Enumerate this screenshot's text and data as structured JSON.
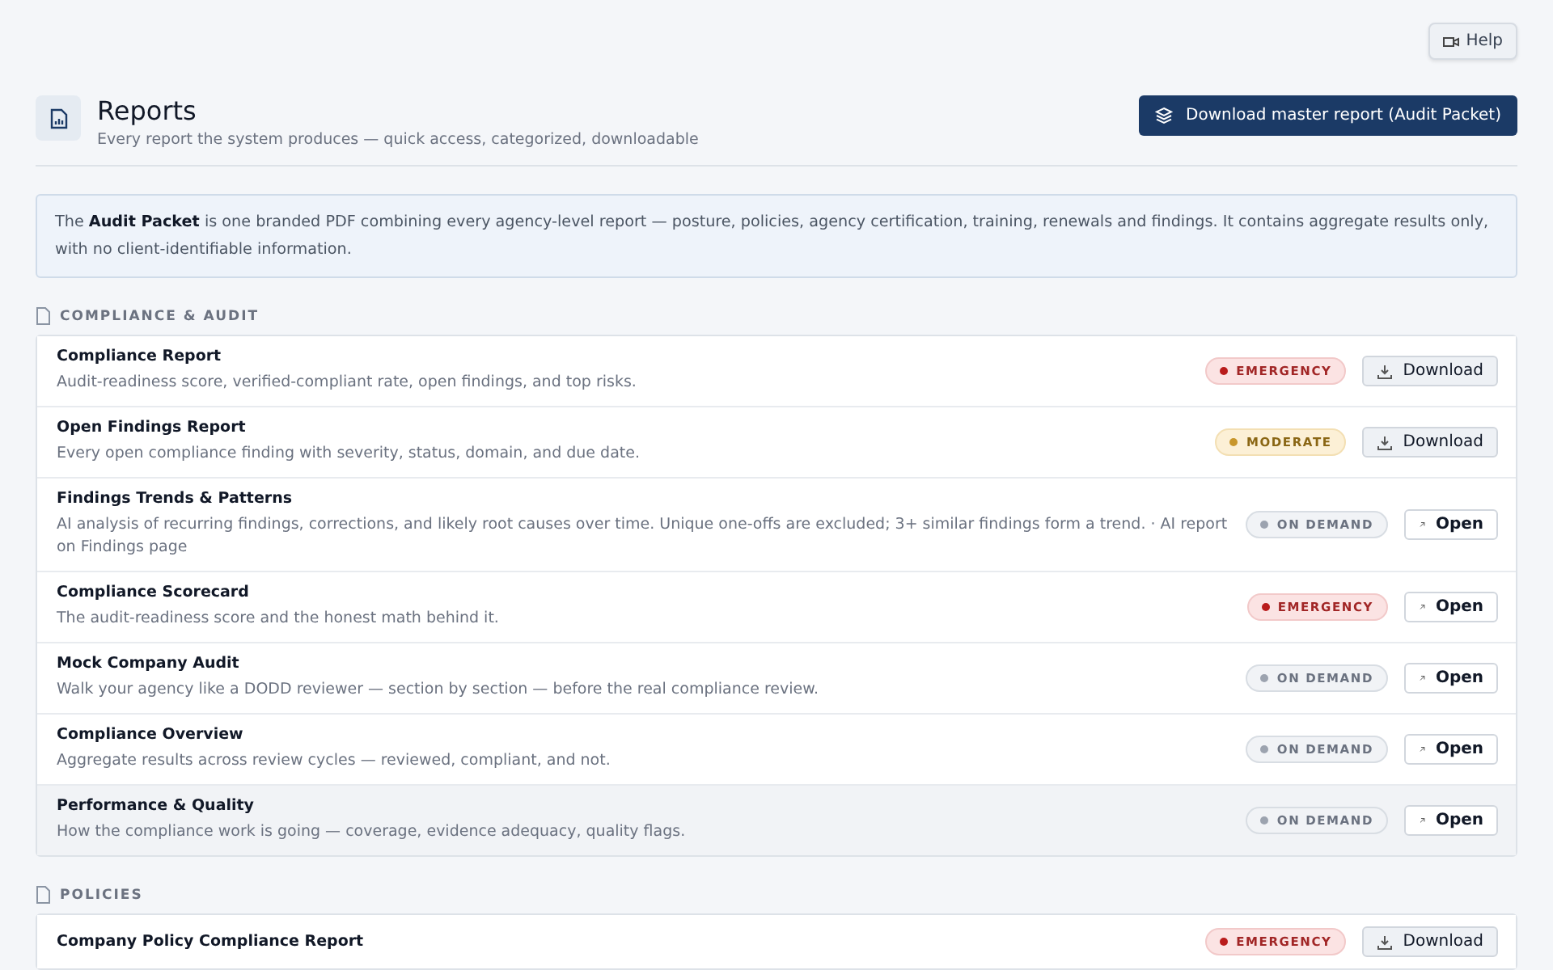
{
  "help_button": "Help",
  "header": {
    "title": "Reports",
    "subtitle": "Every report the system produces — quick access, categorized, downloadable",
    "primary_button": "Download master report (Audit Packet)"
  },
  "info": "The **Audit Packet** is one branded PDF combining every agency-level report — posture, policies, agency certification, training, renewals and findings. It contains aggregate results only, with no client-identifiable information.",
  "sections": [
    {
      "title": "COMPLIANCE & AUDIT",
      "reports": [
        {
          "name": "Compliance Report",
          "description": "Audit-readiness score, verified-compliant rate, open findings, and top risks.",
          "badge": {
            "kind": "emergency",
            "label": "EMERGENCY"
          },
          "action": {
            "kind": "download",
            "label": "Download"
          },
          "highlighted": false
        },
        {
          "name": "Open Findings Report",
          "description": "Every open compliance finding with severity, status, domain, and due date.",
          "badge": {
            "kind": "moderate",
            "label": "MODERATE"
          },
          "action": {
            "kind": "download",
            "label": "Download"
          },
          "highlighted": false
        },
        {
          "name": "Findings Trends & Patterns",
          "description": "AI analysis of recurring findings, corrections, and likely root causes over time. Unique one-offs are excluded; 3+ similar findings form a trend. · AI report on Findings page",
          "badge": {
            "kind": "on_demand",
            "label": "ON DEMAND"
          },
          "action": {
            "kind": "open",
            "label": "Open"
          },
          "highlighted": false
        },
        {
          "name": "Compliance Scorecard",
          "description": "The audit-readiness score and the honest math behind it.",
          "badge": {
            "kind": "emergency",
            "label": "EMERGENCY"
          },
          "action": {
            "kind": "open",
            "label": "Open"
          },
          "highlighted": false
        },
        {
          "name": "Mock Company Audit",
          "description": "Walk your agency like a DODD reviewer — section by section — before the real compliance review.",
          "badge": {
            "kind": "on_demand",
            "label": "ON DEMAND"
          },
          "action": {
            "kind": "open",
            "label": "Open"
          },
          "highlighted": false
        },
        {
          "name": "Compliance Overview",
          "description": "Aggregate results across review cycles — reviewed, compliant, and not.",
          "badge": {
            "kind": "on_demand",
            "label": "ON DEMAND"
          },
          "action": {
            "kind": "open",
            "label": "Open"
          },
          "highlighted": false
        },
        {
          "name": "Performance & Quality",
          "description": "How the compliance work is going — coverage, evidence adequacy, quality flags.",
          "badge": {
            "kind": "on_demand",
            "label": "ON DEMAND"
          },
          "action": {
            "kind": "open",
            "label": "Open"
          },
          "highlighted": true
        }
      ]
    },
    {
      "title": "POLICIES",
      "reports": [
        {
          "name": "Company Policy Compliance Report",
          "badge": {
            "kind": "emergency",
            "label": "EMERGENCY"
          },
          "action": {
            "kind": "download",
            "label": "Download"
          },
          "highlighted": false
        }
      ]
    }
  ]
}
